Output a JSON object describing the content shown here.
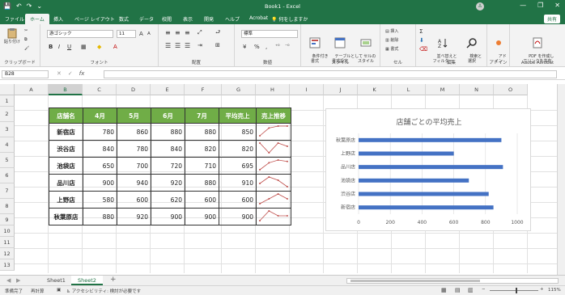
{
  "window": {
    "title": "Book1 - Excel",
    "minimize": "—",
    "restore": "❐",
    "close": "✕",
    "avatar": "♙"
  },
  "qat": {
    "save": "💾",
    "undo": "↶",
    "redo": "↷",
    "more": "⌄"
  },
  "tabs": [
    "ファイル",
    "ホーム",
    "挿入",
    "ページ レイアウト",
    "数式",
    "データ",
    "校閲",
    "表示",
    "開発",
    "ヘルプ",
    "Acrobat"
  ],
  "active_tab": "ホーム",
  "tell_me": "何をしますか",
  "share": "共有",
  "ribbon": {
    "clipboard": {
      "label": "クリップボード",
      "paste": "貼り付け"
    },
    "font": {
      "label": "フォント",
      "name": "游ゴシック",
      "size": "11",
      "bold": "B",
      "italic": "I",
      "underline": "U",
      "grow": "A",
      "shrink": "A"
    },
    "alignment": {
      "label": "配置"
    },
    "number": {
      "label": "数値",
      "format": "標準"
    },
    "styles": {
      "label": "スタイル",
      "cond": "条件付き\n書式",
      "table": "テーブルとして\n書式設定",
      "cell": "セルの\nスタイル"
    },
    "cells": {
      "label": "セル",
      "insert": "挿入",
      "delete": "削除",
      "format": "書式"
    },
    "editing": {
      "label": "編集",
      "sort": "並べ替えと\nフィルター",
      "find": "検索と\n選択"
    },
    "addins": {
      "label": "アドイン",
      "btn": "アド\nイン"
    },
    "acrobat": {
      "label": "Adobe Acrobat",
      "btn": "PDF を作成し\nてリンクを共有"
    }
  },
  "formula_bar": {
    "name_box": "B28",
    "cancel": "✕",
    "enter": "✓",
    "fx": "fx",
    "value": ""
  },
  "columns": [
    "A",
    "B",
    "C",
    "D",
    "E",
    "F",
    "G",
    "H",
    "I",
    "J",
    "K",
    "L",
    "M",
    "N",
    "O"
  ],
  "selected_column": "B",
  "rows": [
    "1",
    "2",
    "3",
    "4",
    "5",
    "6",
    "7",
    "8",
    "9",
    "10",
    "11",
    "12",
    "13"
  ],
  "table": {
    "headers": [
      "店舗名",
      "4月",
      "5月",
      "6月",
      "7月",
      "平均売上",
      "売上推移"
    ],
    "rows": [
      {
        "name": "新宿店",
        "v": [
          780,
          860,
          880,
          880
        ],
        "avg": 850
      },
      {
        "name": "渋谷店",
        "v": [
          840,
          780,
          840,
          820
        ],
        "avg": 820
      },
      {
        "name": "池袋店",
        "v": [
          650,
          700,
          720,
          710
        ],
        "avg": 695
      },
      {
        "name": "品川店",
        "v": [
          900,
          940,
          920,
          880
        ],
        "avg": 910
      },
      {
        "name": "上野店",
        "v": [
          580,
          600,
          620,
          600
        ],
        "avg": 600
      },
      {
        "name": "秋葉原店",
        "v": [
          880,
          920,
          900,
          900
        ],
        "avg": 900
      }
    ]
  },
  "chart_data": {
    "type": "bar",
    "title": "店舗ごとの平均売上",
    "categories": [
      "秋葉原店",
      "上野店",
      "品川店",
      "池袋店",
      "渋谷店",
      "新宿店"
    ],
    "values": [
      900,
      600,
      910,
      695,
      820,
      850
    ],
    "xlim": [
      0,
      1000
    ],
    "ticks": [
      "0",
      "200",
      "400",
      "600",
      "800",
      "1000"
    ],
    "color": "#4472c4",
    "orientation": "horizontal",
    "grid": true
  },
  "sheets": [
    "Sheet1",
    "Sheet2"
  ],
  "active_sheet": "Sheet2",
  "add_sheet": "+",
  "status": {
    "ready": "準備完了",
    "calc": "再計算",
    "accessibility": "アクセシビリティ: 検討が必要です",
    "zoom": "115%"
  },
  "colors": {
    "accent": "#217346",
    "header_fill": "#70ad47",
    "bar": "#4472c4",
    "sparkline": "#c0504d"
  }
}
